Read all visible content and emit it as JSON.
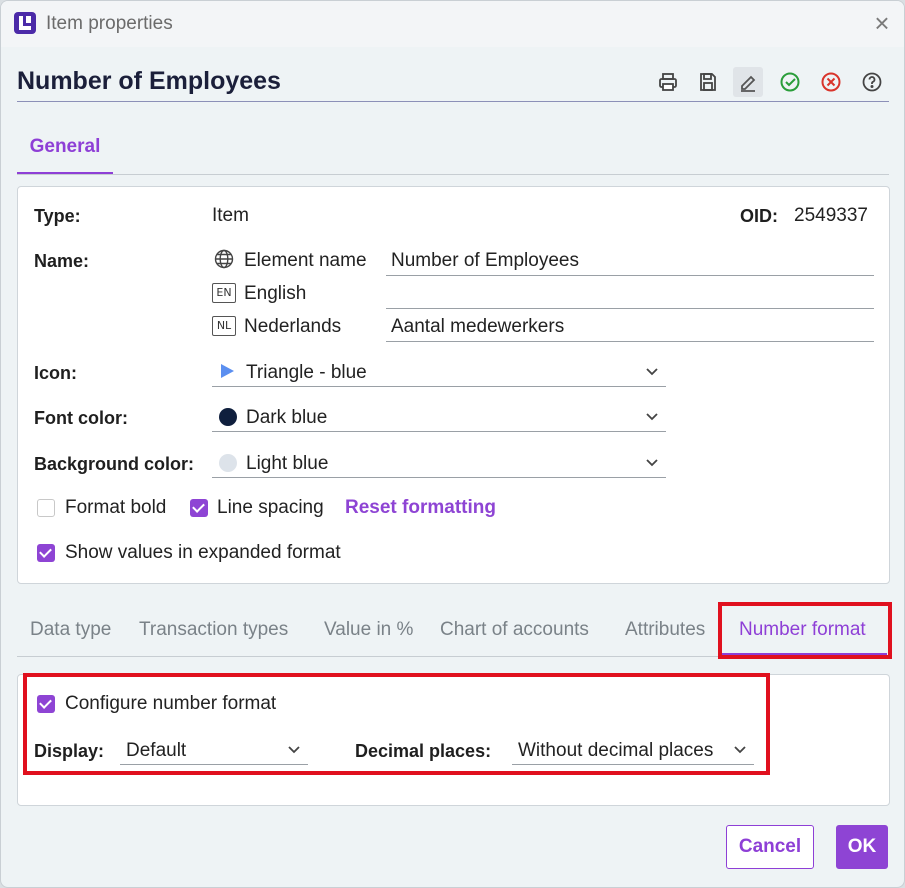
{
  "window": {
    "title": "Item properties"
  },
  "header": {
    "title": "Number of Employees"
  },
  "toolbar": {
    "icons": [
      "print-icon",
      "save-icon",
      "edit-icon",
      "confirm-icon",
      "cancel-icon",
      "help-icon"
    ]
  },
  "tabs": {
    "general": "General"
  },
  "general": {
    "type_label": "Type:",
    "type_value": "Item",
    "oid_label": "OID:",
    "oid_value": "2549337",
    "name_label": "Name:",
    "names": [
      {
        "badge": "",
        "language": "Element name",
        "value": "Number of Employees"
      },
      {
        "badge": "EN",
        "language": "English",
        "value": ""
      },
      {
        "badge": "NL",
        "language": "Nederlands",
        "value": "Aantal medewerkers"
      }
    ],
    "icon_label": "Icon:",
    "icon_value": "Triangle - blue",
    "font_color_label": "Font color:",
    "font_color_value": "Dark blue",
    "bg_color_label": "Background color:",
    "bg_color_value": "Light blue",
    "format_bold_label": "Format bold",
    "format_bold_checked": false,
    "line_spacing_label": "Line spacing",
    "line_spacing_checked": true,
    "reset_formatting": "Reset formatting",
    "expanded_label": "Show values in expanded format",
    "expanded_checked": true
  },
  "lower_tabs": [
    {
      "label": "Data type",
      "active": false
    },
    {
      "label": "Transaction types",
      "active": false
    },
    {
      "label": "Value in %",
      "active": false
    },
    {
      "label": "Chart of accounts",
      "active": false
    },
    {
      "label": "Attributes",
      "active": false
    },
    {
      "label": "Number format",
      "active": true
    }
  ],
  "number_format": {
    "configure_label": "Configure number format",
    "configure_checked": true,
    "display_label": "Display:",
    "display_value": "Default",
    "decimal_label": "Decimal places:",
    "decimal_value": "Without decimal places"
  },
  "buttons": {
    "cancel": "Cancel",
    "ok": "OK"
  },
  "colors": {
    "accent": "#8e44d4",
    "highlight_red": "#e0101e",
    "triangle_blue": "#5b8ff0",
    "dark_blue": "#0f1f3d",
    "light_blue": "#dde3ea",
    "confirm_green": "#2a9d3a",
    "cancel_red": "#d9342b"
  }
}
